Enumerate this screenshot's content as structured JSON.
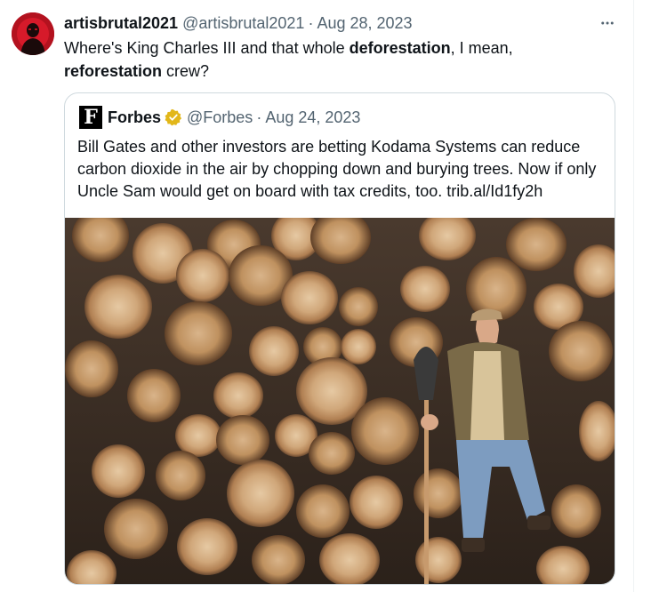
{
  "tweet": {
    "author_name": "artisbrutal2021",
    "author_handle": "@artisbrutal2021",
    "separator": "·",
    "date": "Aug 28, 2023",
    "text_part1": "Where's King Charles III and that whole ",
    "text_bold1": "deforestation",
    "text_part2": ", I mean, ",
    "text_bold2": "reforestation",
    "text_part3": " crew?"
  },
  "quoted_tweet": {
    "logo_letter": "F",
    "author_name": "Forbes",
    "author_handle": "@Forbes",
    "separator": "·",
    "date": "Aug 24, 2023",
    "text": "Bill Gates and other investors are betting Kodama Systems can reduce carbon dioxide in the air by chopping down and burying trees. Now if only Uncle Sam would get on board with tax credits, too. trib.al/Id1fy2h"
  },
  "icons": {
    "more": "more-horizontal-icon",
    "verified": "verified-gold-badge-icon"
  },
  "colors": {
    "text": "#0f1419",
    "secondary": "#536471",
    "border": "#cfd9de",
    "verified_gold": "#e2b719"
  }
}
